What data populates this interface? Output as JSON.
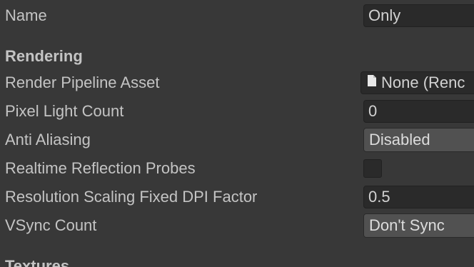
{
  "name_row": {
    "label": "Name",
    "value": "Only"
  },
  "rendering": {
    "header": "Rendering",
    "render_pipeline_asset": {
      "label": "Render Pipeline Asset",
      "value": "None (Renc",
      "icon": "document-icon"
    },
    "pixel_light_count": {
      "label": "Pixel Light Count",
      "value": "0"
    },
    "anti_aliasing": {
      "label": "Anti Aliasing",
      "value": "Disabled"
    },
    "realtime_reflection_probes": {
      "label": "Realtime Reflection Probes",
      "checked": false
    },
    "resolution_scaling": {
      "label": "Resolution Scaling Fixed DPI Factor",
      "value": "0.5"
    },
    "vsync_count": {
      "label": "VSync Count",
      "value": "Don't Sync"
    }
  },
  "textures": {
    "header": "Textures"
  }
}
